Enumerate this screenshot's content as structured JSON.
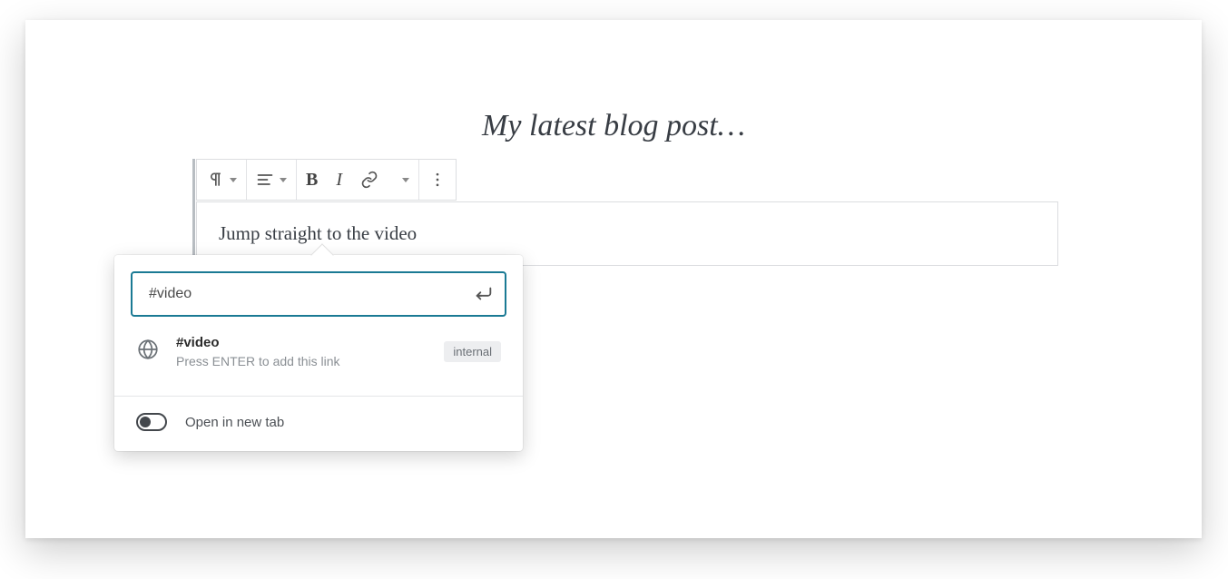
{
  "page": {
    "title": "My latest blog post…"
  },
  "block": {
    "paragraph_text": "Jump straight to the video"
  },
  "toolbar": {
    "bold_glyph": "B",
    "italic_glyph": "I"
  },
  "link_popover": {
    "search_value": "#video",
    "suggestion": {
      "title": "#video",
      "subtitle": "Press ENTER to add this link",
      "badge": "internal"
    },
    "open_new_tab_label": "Open in new tab"
  }
}
